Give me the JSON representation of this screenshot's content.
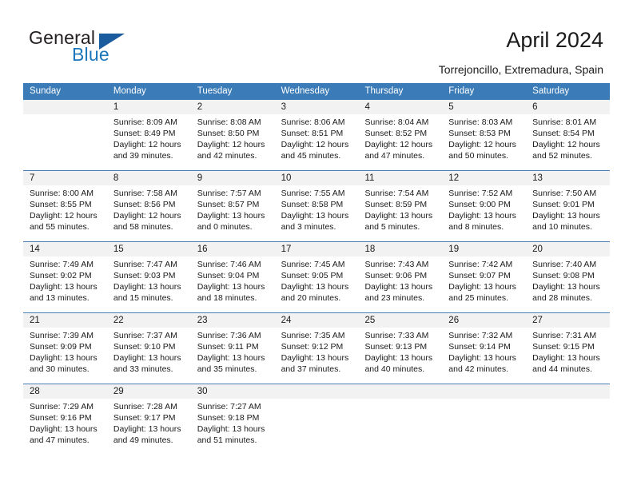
{
  "brand": {
    "name_part1": "General",
    "name_part2": "Blue",
    "triangle_icon": "blue-triangle-icon",
    "accent_color": "#1b76bc"
  },
  "header": {
    "title": "April 2024",
    "subtitle": "Torrejoncillo, Extremadura, Spain"
  },
  "theme": {
    "header_blue": "#3b7cb8",
    "daynum_band": "#f2f2f2",
    "row_divider": "#4a7fb5"
  },
  "calendar": {
    "weekdays": [
      "Sunday",
      "Monday",
      "Tuesday",
      "Wednesday",
      "Thursday",
      "Friday",
      "Saturday"
    ],
    "weeks": [
      {
        "days": [
          {
            "num": "",
            "lines": []
          },
          {
            "num": "1",
            "lines": [
              "Sunrise: 8:09 AM",
              "Sunset: 8:49 PM",
              "Daylight: 12 hours",
              "and 39 minutes."
            ]
          },
          {
            "num": "2",
            "lines": [
              "Sunrise: 8:08 AM",
              "Sunset: 8:50 PM",
              "Daylight: 12 hours",
              "and 42 minutes."
            ]
          },
          {
            "num": "3",
            "lines": [
              "Sunrise: 8:06 AM",
              "Sunset: 8:51 PM",
              "Daylight: 12 hours",
              "and 45 minutes."
            ]
          },
          {
            "num": "4",
            "lines": [
              "Sunrise: 8:04 AM",
              "Sunset: 8:52 PM",
              "Daylight: 12 hours",
              "and 47 minutes."
            ]
          },
          {
            "num": "5",
            "lines": [
              "Sunrise: 8:03 AM",
              "Sunset: 8:53 PM",
              "Daylight: 12 hours",
              "and 50 minutes."
            ]
          },
          {
            "num": "6",
            "lines": [
              "Sunrise: 8:01 AM",
              "Sunset: 8:54 PM",
              "Daylight: 12 hours",
              "and 52 minutes."
            ]
          }
        ]
      },
      {
        "days": [
          {
            "num": "7",
            "lines": [
              "Sunrise: 8:00 AM",
              "Sunset: 8:55 PM",
              "Daylight: 12 hours",
              "and 55 minutes."
            ]
          },
          {
            "num": "8",
            "lines": [
              "Sunrise: 7:58 AM",
              "Sunset: 8:56 PM",
              "Daylight: 12 hours",
              "and 58 minutes."
            ]
          },
          {
            "num": "9",
            "lines": [
              "Sunrise: 7:57 AM",
              "Sunset: 8:57 PM",
              "Daylight: 13 hours",
              "and 0 minutes."
            ]
          },
          {
            "num": "10",
            "lines": [
              "Sunrise: 7:55 AM",
              "Sunset: 8:58 PM",
              "Daylight: 13 hours",
              "and 3 minutes."
            ]
          },
          {
            "num": "11",
            "lines": [
              "Sunrise: 7:54 AM",
              "Sunset: 8:59 PM",
              "Daylight: 13 hours",
              "and 5 minutes."
            ]
          },
          {
            "num": "12",
            "lines": [
              "Sunrise: 7:52 AM",
              "Sunset: 9:00 PM",
              "Daylight: 13 hours",
              "and 8 minutes."
            ]
          },
          {
            "num": "13",
            "lines": [
              "Sunrise: 7:50 AM",
              "Sunset: 9:01 PM",
              "Daylight: 13 hours",
              "and 10 minutes."
            ]
          }
        ]
      },
      {
        "days": [
          {
            "num": "14",
            "lines": [
              "Sunrise: 7:49 AM",
              "Sunset: 9:02 PM",
              "Daylight: 13 hours",
              "and 13 minutes."
            ]
          },
          {
            "num": "15",
            "lines": [
              "Sunrise: 7:47 AM",
              "Sunset: 9:03 PM",
              "Daylight: 13 hours",
              "and 15 minutes."
            ]
          },
          {
            "num": "16",
            "lines": [
              "Sunrise: 7:46 AM",
              "Sunset: 9:04 PM",
              "Daylight: 13 hours",
              "and 18 minutes."
            ]
          },
          {
            "num": "17",
            "lines": [
              "Sunrise: 7:45 AM",
              "Sunset: 9:05 PM",
              "Daylight: 13 hours",
              "and 20 minutes."
            ]
          },
          {
            "num": "18",
            "lines": [
              "Sunrise: 7:43 AM",
              "Sunset: 9:06 PM",
              "Daylight: 13 hours",
              "and 23 minutes."
            ]
          },
          {
            "num": "19",
            "lines": [
              "Sunrise: 7:42 AM",
              "Sunset: 9:07 PM",
              "Daylight: 13 hours",
              "and 25 minutes."
            ]
          },
          {
            "num": "20",
            "lines": [
              "Sunrise: 7:40 AM",
              "Sunset: 9:08 PM",
              "Daylight: 13 hours",
              "and 28 minutes."
            ]
          }
        ]
      },
      {
        "days": [
          {
            "num": "21",
            "lines": [
              "Sunrise: 7:39 AM",
              "Sunset: 9:09 PM",
              "Daylight: 13 hours",
              "and 30 minutes."
            ]
          },
          {
            "num": "22",
            "lines": [
              "Sunrise: 7:37 AM",
              "Sunset: 9:10 PM",
              "Daylight: 13 hours",
              "and 33 minutes."
            ]
          },
          {
            "num": "23",
            "lines": [
              "Sunrise: 7:36 AM",
              "Sunset: 9:11 PM",
              "Daylight: 13 hours",
              "and 35 minutes."
            ]
          },
          {
            "num": "24",
            "lines": [
              "Sunrise: 7:35 AM",
              "Sunset: 9:12 PM",
              "Daylight: 13 hours",
              "and 37 minutes."
            ]
          },
          {
            "num": "25",
            "lines": [
              "Sunrise: 7:33 AM",
              "Sunset: 9:13 PM",
              "Daylight: 13 hours",
              "and 40 minutes."
            ]
          },
          {
            "num": "26",
            "lines": [
              "Sunrise: 7:32 AM",
              "Sunset: 9:14 PM",
              "Daylight: 13 hours",
              "and 42 minutes."
            ]
          },
          {
            "num": "27",
            "lines": [
              "Sunrise: 7:31 AM",
              "Sunset: 9:15 PM",
              "Daylight: 13 hours",
              "and 44 minutes."
            ]
          }
        ]
      },
      {
        "days": [
          {
            "num": "28",
            "lines": [
              "Sunrise: 7:29 AM",
              "Sunset: 9:16 PM",
              "Daylight: 13 hours",
              "and 47 minutes."
            ]
          },
          {
            "num": "29",
            "lines": [
              "Sunrise: 7:28 AM",
              "Sunset: 9:17 PM",
              "Daylight: 13 hours",
              "and 49 minutes."
            ]
          },
          {
            "num": "30",
            "lines": [
              "Sunrise: 7:27 AM",
              "Sunset: 9:18 PM",
              "Daylight: 13 hours",
              "and 51 minutes."
            ]
          },
          {
            "num": "",
            "lines": []
          },
          {
            "num": "",
            "lines": []
          },
          {
            "num": "",
            "lines": []
          },
          {
            "num": "",
            "lines": []
          }
        ]
      }
    ]
  }
}
